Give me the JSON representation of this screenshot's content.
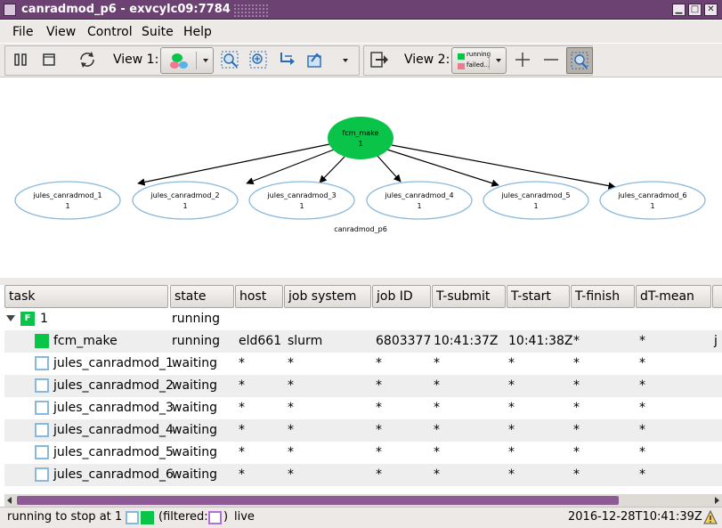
{
  "window": {
    "title": "canradmod_p6 - exvcylc09:7784"
  },
  "menu": [
    {
      "label": "File"
    },
    {
      "label": "View"
    },
    {
      "label": "Control"
    },
    {
      "label": "Suite"
    },
    {
      "label": "Help"
    }
  ],
  "toolbar": {
    "view1_label": "View 1:",
    "view2_label": "View 2:",
    "legend_running": "running",
    "legend_failed": "failed...",
    "icons": [
      "pause-icon",
      "stop-icon",
      "refresh-icon",
      "dot-graph-icon",
      "zoom-fit-icon",
      "zoom-in-icon",
      "navigate-icon",
      "toggle-icon",
      "dropdown-icon",
      "switch-view-icon",
      "plus-icon",
      "minus-icon",
      "graph-view-icon"
    ]
  },
  "graph": {
    "root": {
      "name": "fcm_make",
      "cycle": "1"
    },
    "children": [
      {
        "name": "jules_canradmod_1",
        "cycle": "1"
      },
      {
        "name": "jules_canradmod_2",
        "cycle": "1"
      },
      {
        "name": "jules_canradmod_3",
        "cycle": "1"
      },
      {
        "name": "jules_canradmod_4",
        "cycle": "1"
      },
      {
        "name": "jules_canradmod_5",
        "cycle": "1"
      },
      {
        "name": "jules_canradmod_6",
        "cycle": "1"
      }
    ],
    "suite_label": "canradmod_p6",
    "colors": {
      "running": "#0ac44a",
      "waiting": "#88b9dd",
      "edge": "#000000"
    }
  },
  "table": {
    "columns": [
      "task",
      "state",
      "host",
      "job system",
      "job ID",
      "T-submit",
      "T-start",
      "T-finish",
      "dT-mean",
      ""
    ],
    "family": {
      "name": "1",
      "state": "running"
    },
    "rows": [
      {
        "task": "fcm_make",
        "state": "running",
        "host": "eld661",
        "job_system": "slurm",
        "job_id": "6803377",
        "t_submit": "10:41:37Z",
        "t_start": "10:41:38Z",
        "t_finish": "*",
        "dt_mean": "*",
        "extra": "j"
      },
      {
        "task": "jules_canradmod_1",
        "state": "waiting",
        "host": "*",
        "job_system": "*",
        "job_id": "*",
        "t_submit": "*",
        "t_start": "*",
        "t_finish": "*",
        "dt_mean": "*",
        "extra": ""
      },
      {
        "task": "jules_canradmod_2",
        "state": "waiting",
        "host": "*",
        "job_system": "*",
        "job_id": "*",
        "t_submit": "*",
        "t_start": "*",
        "t_finish": "*",
        "dt_mean": "*",
        "extra": ""
      },
      {
        "task": "jules_canradmod_3",
        "state": "waiting",
        "host": "*",
        "job_system": "*",
        "job_id": "*",
        "t_submit": "*",
        "t_start": "*",
        "t_finish": "*",
        "dt_mean": "*",
        "extra": ""
      },
      {
        "task": "jules_canradmod_4",
        "state": "waiting",
        "host": "*",
        "job_system": "*",
        "job_id": "*",
        "t_submit": "*",
        "t_start": "*",
        "t_finish": "*",
        "dt_mean": "*",
        "extra": ""
      },
      {
        "task": "jules_canradmod_5",
        "state": "waiting",
        "host": "*",
        "job_system": "*",
        "job_id": "*",
        "t_submit": "*",
        "t_start": "*",
        "t_finish": "*",
        "dt_mean": "*",
        "extra": ""
      },
      {
        "task": "jules_canradmod_6",
        "state": "waiting",
        "host": "*",
        "job_system": "*",
        "job_id": "*",
        "t_submit": "*",
        "t_start": "*",
        "t_finish": "*",
        "dt_mean": "*",
        "extra": ""
      }
    ]
  },
  "status": {
    "run_text": "running to stop at 1",
    "filtered_open": "(filtered:",
    "filtered_close": ")",
    "mode": "live",
    "timestamp": "2016-12-28T10:41:39Z"
  }
}
